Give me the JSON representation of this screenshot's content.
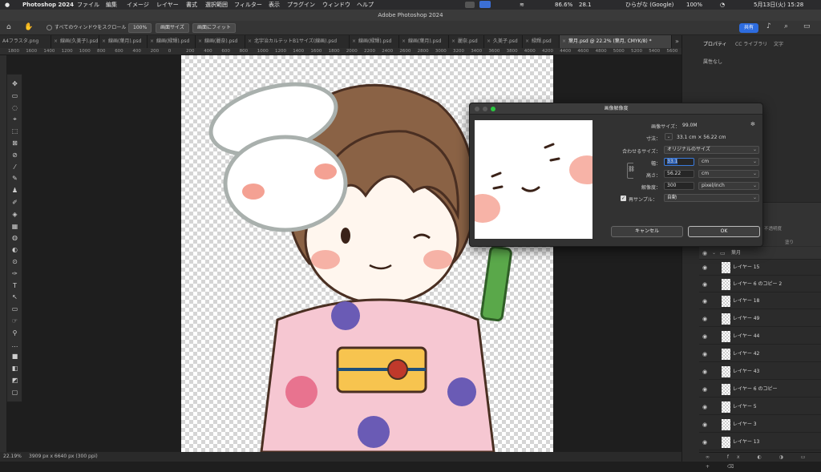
{
  "mac_menubar": {
    "app_name": "Photoshop 2024",
    "menus": [
      "ファイル",
      "編集",
      "イメージ",
      "レイヤー",
      "書式",
      "選択範囲",
      "フィルター",
      "表示",
      "プラグイン",
      "ウィンドウ",
      "ヘルプ"
    ],
    "status": {
      "cpu": "86.6%",
      "temp": "28.1",
      "input_method": "ひらがな (Google)",
      "battery": "100%",
      "datetime": "5月13日(火) 15:28"
    }
  },
  "window": {
    "title": "Adobe Photoshop 2024",
    "share_label": "共有"
  },
  "options_bar": {
    "scroll_all_label": "すべてのウィンドウをスクロール",
    "zoom_100": "100%",
    "fit_screen": "画面サイズ",
    "fill_screen": "画面にフィット"
  },
  "tabs": [
    {
      "label": "A4フラスタ.png",
      "active": false
    },
    {
      "label": "線画(久美子).psd",
      "active": false
    },
    {
      "label": "線画(葉月).psd",
      "active": false
    },
    {
      "label": "線画(緑輝).psd",
      "active": false
    },
    {
      "label": "線画(麗奈).psd",
      "active": false
    },
    {
      "label": "北宇治カルテットB1サイズ(線画).psd",
      "active": false
    },
    {
      "label": "線画(緑輝).psd",
      "active": false
    },
    {
      "label": "線画(葉月).psd",
      "active": false
    },
    {
      "label": "麗奈.psd",
      "active": false
    },
    {
      "label": "久美子.psd",
      "active": false
    },
    {
      "label": "緑輝.psd",
      "active": false
    },
    {
      "label": "葉月.psd @ 22.2% (葉月, CMYK/8) *",
      "active": true
    }
  ],
  "ruler_ticks": [
    "1800",
    "1600",
    "1400",
    "1200",
    "1000",
    "800",
    "600",
    "400",
    "200",
    "0",
    "200",
    "400",
    "600",
    "800",
    "1000",
    "1200",
    "1400",
    "1600",
    "1800",
    "2000",
    "2200",
    "2400",
    "2600",
    "2800",
    "3000",
    "3200",
    "3400",
    "3600",
    "3800",
    "4000",
    "4200",
    "4400",
    "4600",
    "4800",
    "5000",
    "5200",
    "5400",
    "5600"
  ],
  "status_bar": {
    "zoom": "22.19%",
    "doc_info": "3909 px x 6640 px (300 ppi)"
  },
  "panel": {
    "tabs": [
      "プロパティ",
      "CC ライブラリ",
      "文字"
    ],
    "no_properties": "属性なし",
    "group_name": "葉月",
    "opacity_label": "不透明度",
    "fill_label": "塗り",
    "layers": [
      "レイヤー 15",
      "レイヤー 6 のコピー 2",
      "レイヤー 18",
      "レイヤー 49",
      "レイヤー 44",
      "レイヤー 42",
      "レイヤー 43",
      "レイヤー 6 のコピー",
      "レイヤー 5",
      "レイヤー 3",
      "レイヤー 13"
    ]
  },
  "dialog": {
    "title": "画像解像度",
    "image_size_label": "画像サイズ：",
    "image_size_value": "99.0M",
    "dimensions_label": "寸法：",
    "dimensions_value": "33.1 cm × 56.22 cm",
    "fit_to_label": "合わせるサイズ：",
    "fit_to_value": "オリジナルのサイズ",
    "width_label": "幅：",
    "width_value": "33.1",
    "width_unit": "cm",
    "height_label": "高さ：",
    "height_value": "56.22",
    "height_unit": "cm",
    "resolution_label": "解像度：",
    "resolution_value": "300",
    "resolution_unit": "pixel/inch",
    "resample_label": "再サンプル：",
    "resample_value": "自動",
    "cancel": "キャンセル",
    "ok": "OK"
  }
}
